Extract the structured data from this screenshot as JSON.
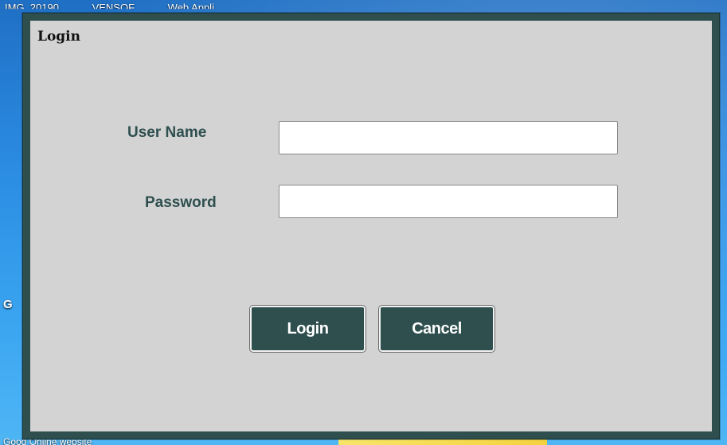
{
  "desktop": {
    "top_items": [
      "IMG_20190",
      "VENSOF",
      "Web Appli"
    ],
    "middle_label": "G",
    "bottom_label": "Good Online website"
  },
  "dialog": {
    "title": "Login",
    "user_label": "User Name",
    "user_value": "",
    "password_label": "Password",
    "password_value": "",
    "login_button": "Login",
    "cancel_button": "Cancel"
  },
  "colors": {
    "frame": "#2f4f4f",
    "panel": "#d3d3d3",
    "button": "#2f4f4f",
    "label": "#2f4f4f"
  }
}
